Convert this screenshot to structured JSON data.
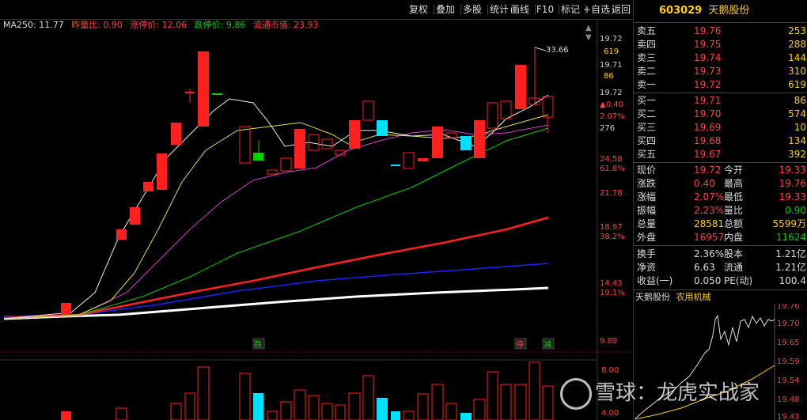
{
  "toolbar": {
    "buttons": [
      "复权",
      "叠加",
      "多股",
      "统计",
      "画线",
      "F10",
      "标记",
      "+自选",
      "返回"
    ]
  },
  "ma_info": {
    "ma250": "MA250: 11.77",
    "ratio": "昨量比: 0.90",
    "limit_up": "涨停价: 12.06",
    "limit_down": "跌停价: 9.86",
    "float_cap": "流通市值: 23.93"
  },
  "chart": {
    "high_label": "33.66",
    "markers": {
      "die": "跌",
      "ting": "停",
      "jian": "减"
    }
  },
  "price_axis": {
    "labels": [
      "19.72",
      "619",
      "19.71",
      "86",
      "19.72",
      "▲0.40",
      "2.07%",
      "276",
      "24.58",
      "61.8%",
      "21.78",
      "18.97",
      "38.2%",
      "14.43",
      "19.1%",
      "9.89",
      "8.00",
      "4.00"
    ]
  },
  "stock": {
    "code": "603029",
    "name": "天鹅股份"
  },
  "order_book": {
    "asks": [
      {
        "label": "卖五",
        "price": "19.76",
        "vol": "253"
      },
      {
        "label": "卖四",
        "price": "19.75",
        "vol": "288"
      },
      {
        "label": "卖三",
        "price": "19.74",
        "vol": "144"
      },
      {
        "label": "卖二",
        "price": "19.73",
        "vol": "310"
      },
      {
        "label": "卖一",
        "price": "19.72",
        "vol": "619"
      }
    ],
    "bids": [
      {
        "label": "买一",
        "price": "19.71",
        "vol": "86"
      },
      {
        "label": "买二",
        "price": "19.70",
        "vol": "574"
      },
      {
        "label": "买三",
        "price": "19.69",
        "vol": "10"
      },
      {
        "label": "买四",
        "price": "19.68",
        "vol": "134"
      },
      {
        "label": "买五",
        "price": "19.67",
        "vol": "392"
      }
    ]
  },
  "quote": {
    "rows": [
      {
        "l1": "现价",
        "v1": "19.72",
        "l2": "今开",
        "v2": "19.33"
      },
      {
        "l1": "涨跌",
        "v1": "0.40",
        "l2": "最高",
        "v2": "19.76"
      },
      {
        "l1": "涨幅",
        "v1": "2.07%",
        "l2": "最低",
        "v2": "19.33"
      },
      {
        "l1": "振幅",
        "v1": "2.23%",
        "l2": "量比",
        "v2": "0.90"
      },
      {
        "l1": "总量",
        "v1": "28581",
        "l2": "总额",
        "v2": "5599万"
      },
      {
        "l1": "外盘",
        "v1": "16957",
        "l2": "内盘",
        "v2": "11624"
      }
    ],
    "rows2": [
      {
        "l1": "换手",
        "v1": "2.36%",
        "l2": "股本",
        "v2": "1.21亿"
      },
      {
        "l1": "净资",
        "v1": "6.63",
        "l2": "流通",
        "v2": "1.21亿"
      },
      {
        "l1": "收益(一)",
        "v1": "0.050",
        "l2": "PE(动)",
        "v2": "100.4"
      }
    ]
  },
  "mini_chart": {
    "name": "天鹅股份",
    "sector": "农用机械",
    "axis": [
      "19.76",
      "19.70",
      "19.65",
      "19.59",
      "19.54",
      "19.48",
      "19.43"
    ]
  },
  "watermark": "雪球：龙虎实战家",
  "colors": {
    "up": "#ff2020",
    "down": "#00e0ff",
    "green": "#00d000",
    "yellow": "#ffd000"
  }
}
